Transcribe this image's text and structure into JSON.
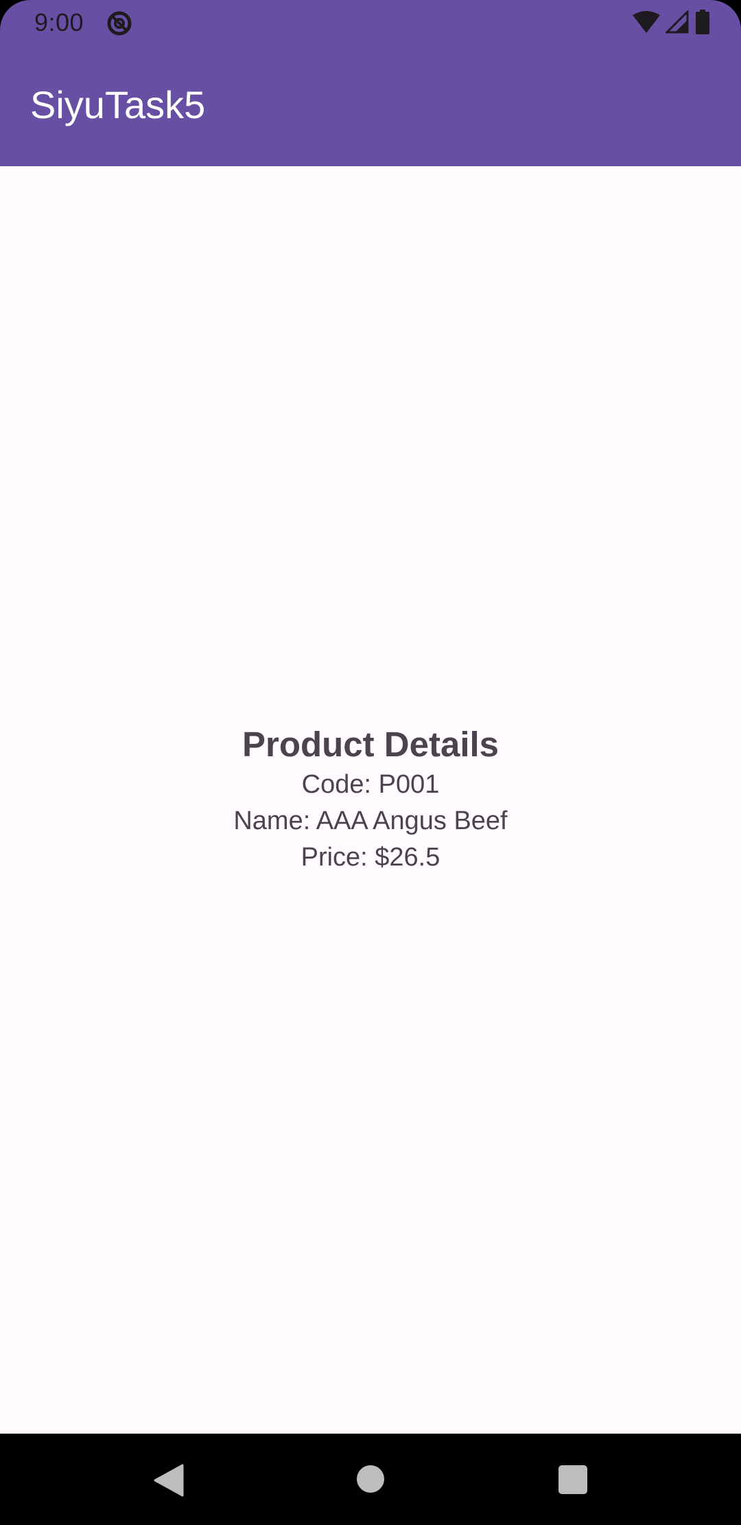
{
  "status_bar": {
    "time": "9:00",
    "icons": [
      "app-notification-icon",
      "wifi-icon",
      "cell-signal-icon",
      "battery-icon"
    ]
  },
  "app_bar": {
    "title": "SiyuTask5",
    "color": "#6750a4"
  },
  "product": {
    "heading": "Product Details",
    "code_line": "Code: P001",
    "name_line": "Name: AAA Angus Beef",
    "price_line": "Price: $26.5"
  },
  "nav_bar": {
    "buttons": [
      "back-icon",
      "home-icon",
      "recents-icon"
    ]
  }
}
